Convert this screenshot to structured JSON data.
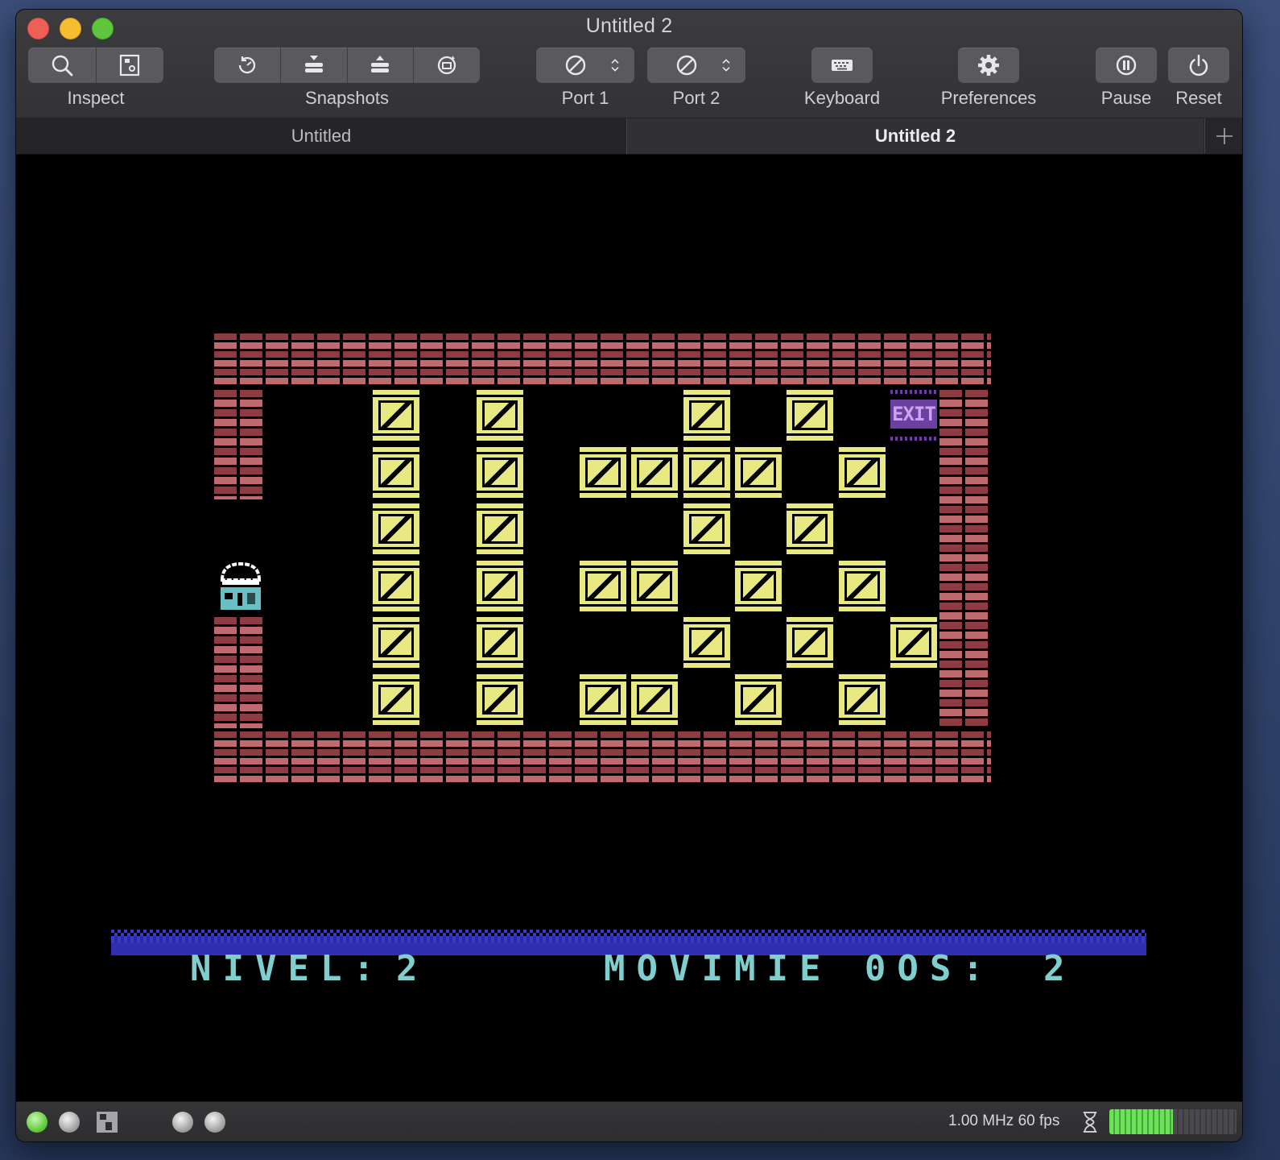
{
  "window": {
    "title": "Untitled 2"
  },
  "toolbar": {
    "inspect_label": "Inspect",
    "snapshots_label": "Snapshots",
    "port1_label": "Port 1",
    "port2_label": "Port 2",
    "keyboard_label": "Keyboard",
    "preferences_label": "Preferences",
    "pause_label": "Pause",
    "reset_label": "Reset"
  },
  "tabs": [
    {
      "label": "Untitled",
      "active": false
    },
    {
      "label": "Untitled 2",
      "active": true
    }
  ],
  "game": {
    "exit_label": "EXIT",
    "level_label": "NIVEL:",
    "level_value": "2",
    "moves_label": "MOVIMIE 0OS:",
    "moves_value": "2",
    "colors": {
      "brick": "#a34d54",
      "crate": "#e9e983",
      "exit": "#6d3fa0",
      "hud_text": "#7fcfcf",
      "hud_bar": "#2f2fb0"
    }
  },
  "status": {
    "speed_text": "1.00 MHz 60 fps",
    "speed_meter_fraction": 0.5,
    "leds": [
      "green",
      "gray",
      "gray",
      "gray"
    ]
  },
  "icons": [
    "magnifier-icon",
    "inspector-icon",
    "rewind-icon",
    "take-snapshot-icon",
    "restore-snapshot-icon",
    "browse-snapshot-icon",
    "no-device-icon",
    "updown-chevron-icon",
    "keyboard-icon",
    "gear-icon",
    "pause-icon",
    "power-icon",
    "plus-icon",
    "hourglass-icon",
    "disk-icon"
  ]
}
